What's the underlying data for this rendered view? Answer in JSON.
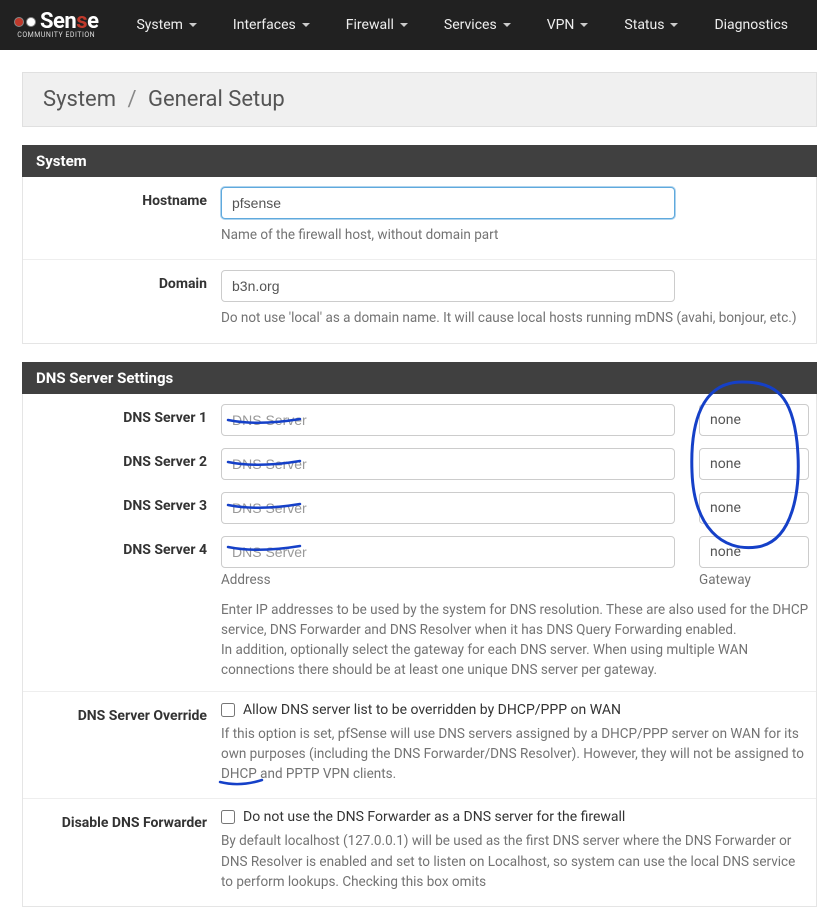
{
  "nav": {
    "items": [
      {
        "label": "System"
      },
      {
        "label": "Interfaces"
      },
      {
        "label": "Firewall"
      },
      {
        "label": "Services"
      },
      {
        "label": "VPN"
      },
      {
        "label": "Status"
      },
      {
        "label": "Diagnostics"
      }
    ]
  },
  "logo": {
    "text_pf": "Sen",
    "text_accent": "s",
    "text_e": "e",
    "sub": "COMMUNITY EDITION"
  },
  "breadcrumb": {
    "root": "System",
    "sep": "/",
    "current": "General Setup"
  },
  "panels": {
    "system": {
      "title": "System",
      "hostname": {
        "label": "Hostname",
        "value": "pfsense",
        "help": "Name of the firewall host, without domain part"
      },
      "domain": {
        "label": "Domain",
        "value": "b3n.org",
        "help": "Do not use 'local' as a domain name. It will cause local hosts running mDNS (avahi, bonjour, etc.)"
      }
    },
    "dns": {
      "title": "DNS Server Settings",
      "servers": [
        {
          "label": "DNS Server 1",
          "placeholder": "DNS Server",
          "gateway": "none"
        },
        {
          "label": "DNS Server 2",
          "placeholder": "DNS Server",
          "gateway": "none"
        },
        {
          "label": "DNS Server 3",
          "placeholder": "DNS Server",
          "gateway": "none"
        },
        {
          "label": "DNS Server 4",
          "placeholder": "DNS Server",
          "gateway": "none"
        }
      ],
      "sublabel_address": "Address",
      "sublabel_gateway": "Gateway",
      "help": "Enter IP addresses to be used by the system for DNS resolution. These are also used for the DHCP service, DNS Forwarder and DNS Resolver when it has DNS Query Forwarding enabled.\nIn addition, optionally select the gateway for each DNS server. When using multiple WAN connections there should be at least one unique DNS server per gateway.",
      "override": {
        "label": "DNS Server Override",
        "checkbox_label": "Allow DNS server list to be overridden by DHCP/PPP on WAN",
        "help": "If this option is set, pfSense will use DNS servers assigned by a DHCP/PPP server on WAN for its own purposes (including the DNS Forwarder/DNS Resolver). However, they will not be assigned to DHCP and PPTP VPN clients."
      },
      "disable_forwarder": {
        "label": "Disable DNS Forwarder",
        "checkbox_label": "Do not use the DNS Forwarder as a DNS server for the firewall",
        "help": "By default localhost (127.0.0.1) will be used as the first DNS server where the DNS Forwarder or DNS Resolver is enabled and set to listen on Localhost, so system can use the local DNS service to perform lookups. Checking this box omits"
      }
    }
  }
}
